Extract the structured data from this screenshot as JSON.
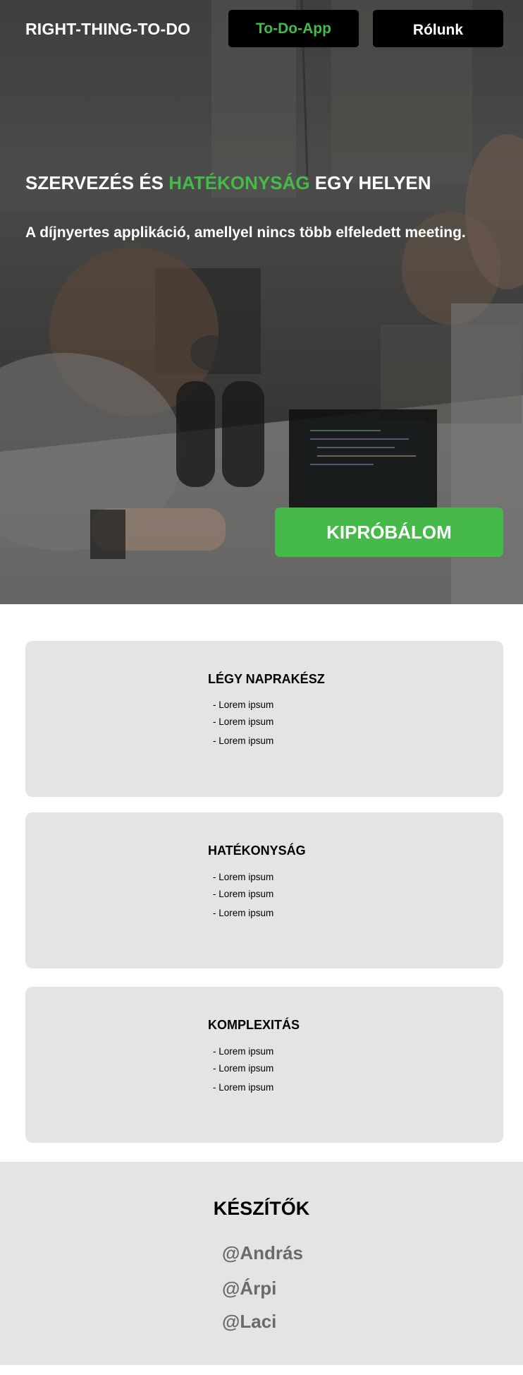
{
  "nav": {
    "brand": "RIGHT-THING-TO-DO",
    "todo_label": "To-Do-App",
    "about_label": "Rólunk"
  },
  "hero": {
    "headline_before": "SZERVEZÉS ÉS ",
    "headline_accent": "HATÉKONYSÁG",
    "headline_after": " EGY HELYEN",
    "subline": "A díjnyertes applikáció, amellyel nincs több elfeledett meeting.",
    "cta_label": "KIPRÓBÁLOM"
  },
  "features": [
    {
      "title": "LÉGY NAPRAKÉSZ",
      "items": [
        "- Lorem ipsum",
        "- Lorem ipsum",
        "- Lorem ipsum"
      ]
    },
    {
      "title": "HATÉKONYSÁG",
      "items": [
        "- Lorem ipsum",
        "- Lorem ipsum",
        "- Lorem ipsum"
      ]
    },
    {
      "title": "KOMPLEXITÁS",
      "items": [
        "- Lorem ipsum",
        "- Lorem ipsum",
        "- Lorem ipsum"
      ]
    }
  ],
  "credits": {
    "title": "KÉSZÍTŐK",
    "authors": [
      "@András",
      "@Árpi",
      "@Laci"
    ]
  },
  "colors": {
    "accent_green": "#46b94b",
    "nav_button": "#000000",
    "card_bg": "#e4e4e4",
    "author_text": "#6a6a6a"
  }
}
